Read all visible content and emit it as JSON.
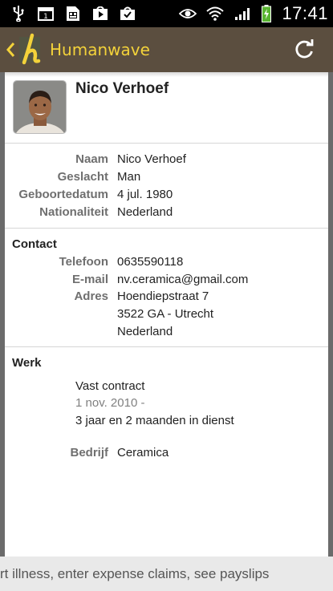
{
  "status_bar": {
    "time": "17:41",
    "left_icons": [
      "usb-icon",
      "calendar-icon",
      "sim-card-icon",
      "play-store-icon",
      "shopping-bag-icon"
    ],
    "right_icons": [
      "eye-icon",
      "wifi-icon",
      "signal-icon",
      "battery-charging-icon"
    ]
  },
  "action_bar": {
    "title": "Humanwave",
    "logo_letter": "h",
    "back_icon": "chevron-left-icon",
    "refresh_icon": "refresh-icon"
  },
  "profile": {
    "name": "Nico Verhoef"
  },
  "personal": [
    {
      "label": "Naam",
      "value": "Nico Verhoef"
    },
    {
      "label": "Geslacht",
      "value": "Man"
    },
    {
      "label": "Geboortedatum",
      "value": "4 jul. 1980"
    },
    {
      "label": "Nationaliteit",
      "value": "Nederland"
    }
  ],
  "contact": {
    "title": "Contact",
    "phone_label": "Telefoon",
    "phone": "0635590118",
    "email_label": "E-mail",
    "email": "nv.ceramica@gmail.com",
    "address_label": "Adres",
    "address_lines": [
      "Hoendiepstraat 7",
      "3522 GA  - Utrecht",
      "Nederland"
    ]
  },
  "werk": {
    "title": "Werk",
    "contract": "Vast contract",
    "start": "1 nov. 2010 -",
    "duration": "3 jaar en 2 maanden in dienst",
    "company_label": "Bedrijf",
    "company": "Ceramica"
  },
  "background": {
    "text": "rt illness, enter expense claims, see payslips"
  },
  "colors": {
    "action_bar": "#5b4e3f",
    "title": "#f3d23a",
    "label": "#6f6f6f"
  }
}
